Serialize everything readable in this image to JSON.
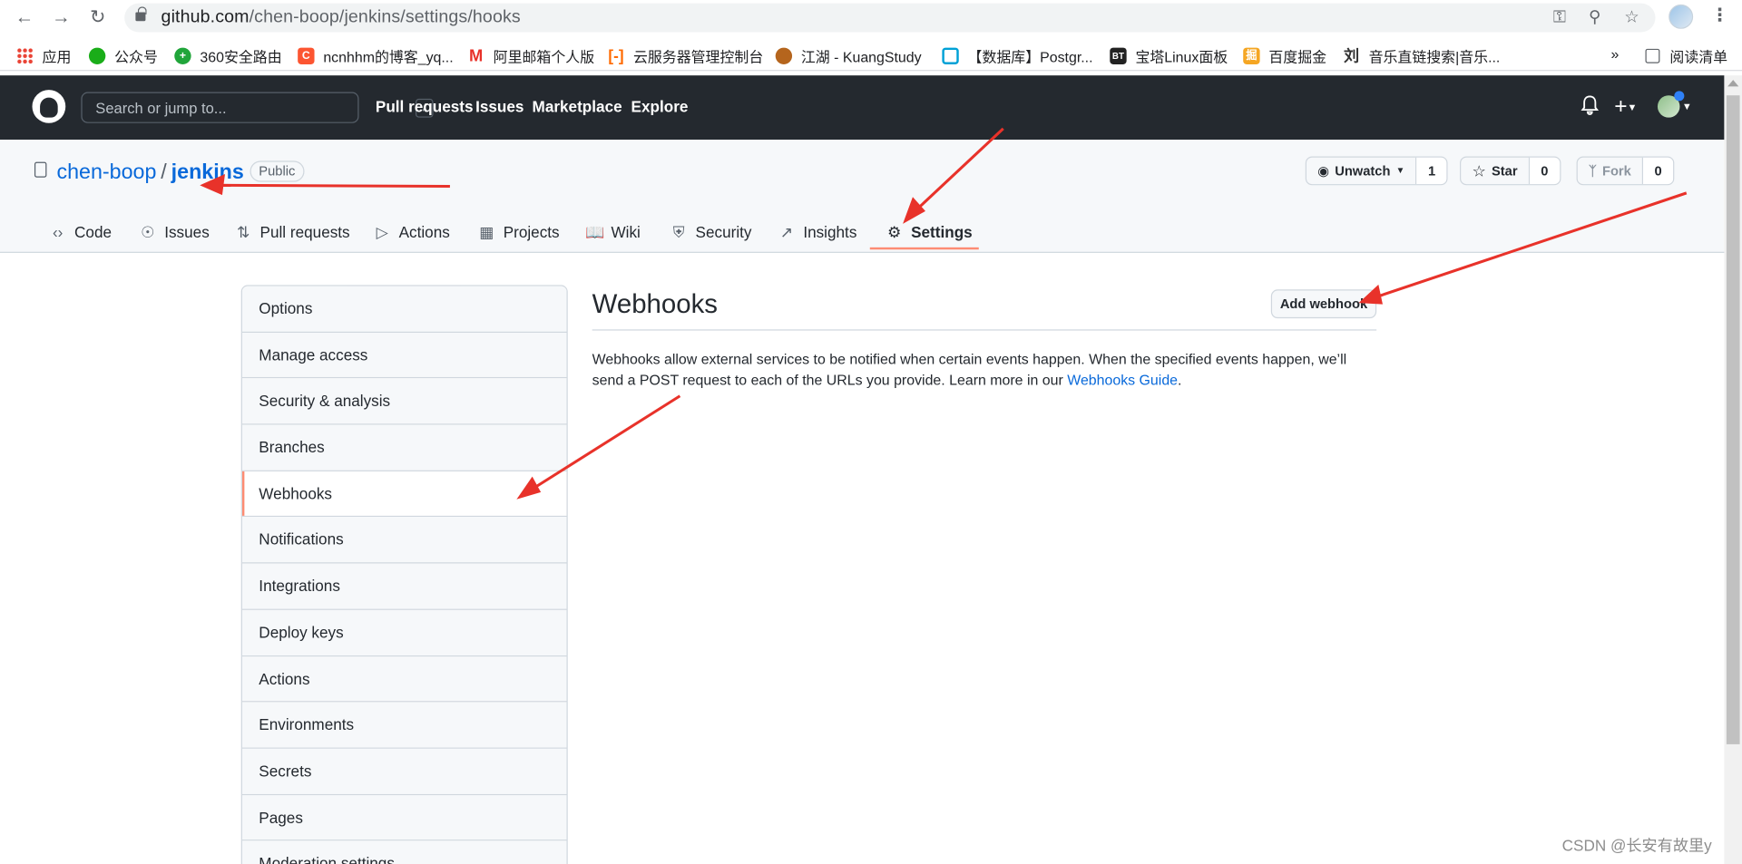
{
  "browser": {
    "url_host": "github.com",
    "url_path": "/chen-boop/jenkins/settings/hooks",
    "bookmarks": [
      "应用",
      "公众号",
      "360安全路由",
      "ncnhhm的博客_yq...",
      "阿里邮箱个人版",
      "云服务器管理控制台",
      "江湖 - KuangStudy",
      "【数据库】Postgr...",
      "宝塔Linux面板",
      "百度掘金",
      "音乐直链搜索|音乐..."
    ],
    "bookmark_icons": [
      {
        "char": "",
        "color": "#e8453c"
      },
      {
        "char": "",
        "color": "#1aad19"
      },
      {
        "char": "",
        "color": "#f5c518"
      },
      {
        "char": "C",
        "color": "#fc5531"
      },
      {
        "char": "M",
        "color": "#ff6a00"
      },
      {
        "char": "",
        "color": "#ff6a00"
      },
      {
        "char": "",
        "color": "#b5651d"
      },
      {
        "char": "",
        "color": "#00a1d6"
      },
      {
        "char": "BT",
        "color": "#20a53a"
      },
      {
        "char": "掘",
        "color": "#f5a623"
      },
      {
        "char": "刘",
        "color": "#333333"
      }
    ],
    "more_bookmarks": "»",
    "reading_list": "阅读清单"
  },
  "github": {
    "search_placeholder": "Search or jump to...",
    "search_shortcut": "/",
    "nav": [
      "Pull requests",
      "Issues",
      "Marketplace",
      "Explore"
    ]
  },
  "repo": {
    "owner": "chen-boop",
    "separator": "/",
    "name": "jenkins",
    "visibility": "Public",
    "unwatch_label": "Unwatch",
    "unwatch_count": "1",
    "star_label": "Star",
    "star_count": "0",
    "fork_label": "Fork",
    "fork_count": "0",
    "tabs": [
      {
        "label": "Code",
        "icon": "code-icon"
      },
      {
        "label": "Issues",
        "icon": "issue-icon"
      },
      {
        "label": "Pull requests",
        "icon": "pull-request-icon"
      },
      {
        "label": "Actions",
        "icon": "play-icon"
      },
      {
        "label": "Projects",
        "icon": "project-icon"
      },
      {
        "label": "Wiki",
        "icon": "book-icon"
      },
      {
        "label": "Security",
        "icon": "shield-icon"
      },
      {
        "label": "Insights",
        "icon": "graph-icon"
      },
      {
        "label": "Settings",
        "icon": "gear-icon"
      }
    ],
    "selected_tab": "Settings"
  },
  "settings": {
    "menu": [
      "Options",
      "Manage access",
      "Security & analysis",
      "Branches",
      "Webhooks",
      "Notifications",
      "Integrations",
      "Deploy keys",
      "Actions",
      "Environments",
      "Secrets",
      "Pages",
      "Moderation settings"
    ],
    "selected_menu": "Webhooks",
    "page_title": "Webhooks",
    "add_button": "Add webhook",
    "description": "Webhooks allow external services to be notified when certain events happen. When the specified events happen, we’ll send a POST request to each of the URLs you provide. Learn more in our ",
    "guide_link": "Webhooks Guide",
    "description_end": "."
  },
  "watermark": "CSDN @长安有故里y",
  "colors": {
    "header_bg": "#24292f",
    "link": "#0969da",
    "selected_accent": "#fd8c73",
    "annotation_arrow": "#e8322a"
  }
}
